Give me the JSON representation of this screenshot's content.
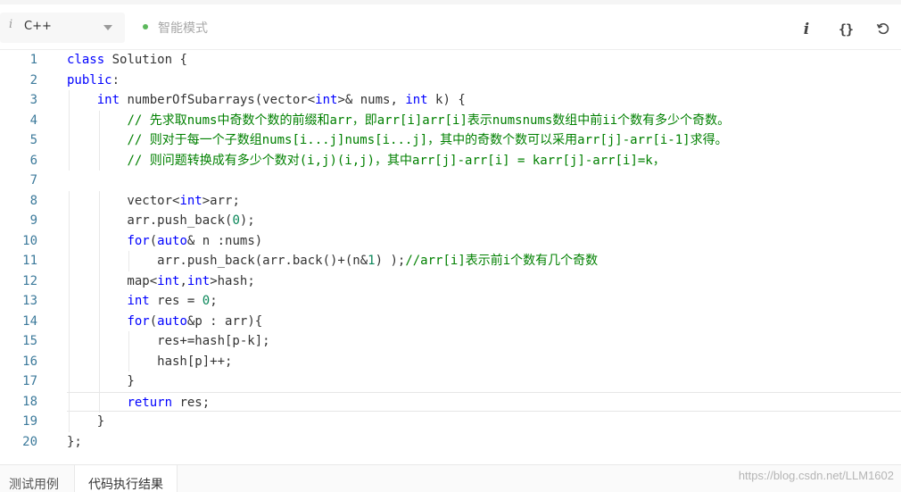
{
  "toolbar": {
    "language": "C++",
    "mode_label": "智能模式",
    "info_glyph": "i",
    "format_glyph": "{}",
    "colors": {
      "mode_dot": "#5cb85c"
    }
  },
  "editor": {
    "lines": [
      {
        "n": "1",
        "tokens": [
          {
            "t": "kw",
            "v": "class"
          },
          {
            "t": "pl",
            "v": " Solution {"
          }
        ]
      },
      {
        "n": "2",
        "tokens": [
          {
            "t": "kw",
            "v": "public"
          },
          {
            "t": "pl",
            "v": ":"
          }
        ]
      },
      {
        "n": "3",
        "tokens": [
          {
            "t": "pl",
            "v": "    "
          },
          {
            "t": "kw",
            "v": "int"
          },
          {
            "t": "pl",
            "v": " numberOfSubarrays(vector<"
          },
          {
            "t": "kw",
            "v": "int"
          },
          {
            "t": "pl",
            "v": ">& nums, "
          },
          {
            "t": "kw",
            "v": "int"
          },
          {
            "t": "pl",
            "v": " k) {"
          }
        ]
      },
      {
        "n": "4",
        "tokens": [
          {
            "t": "pl",
            "v": "        "
          },
          {
            "t": "cm",
            "v": "// 先求取nums中奇数个数的前缀和arr，即arr[i]arr[i]表示numsnums数组中前ii个数有多少个奇数。"
          }
        ]
      },
      {
        "n": "5",
        "tokens": [
          {
            "t": "pl",
            "v": "        "
          },
          {
            "t": "cm",
            "v": "// 则对于每一个子数组nums[i...j]nums[i...j]，其中的奇数个数可以采用arr[j]-arr[i-1]求得。"
          }
        ]
      },
      {
        "n": "6",
        "tokens": [
          {
            "t": "pl",
            "v": "        "
          },
          {
            "t": "cm",
            "v": "// 则问题转换成有多少个数对(i,j)(i,j)，其中arr[j]-arr[i] = karr[j]-arr[i]=k，"
          }
        ]
      },
      {
        "n": "7",
        "tokens": []
      },
      {
        "n": "8",
        "tokens": [
          {
            "t": "pl",
            "v": "        vector<"
          },
          {
            "t": "kw",
            "v": "int"
          },
          {
            "t": "pl",
            "v": ">arr;"
          }
        ]
      },
      {
        "n": "9",
        "tokens": [
          {
            "t": "pl",
            "v": "        arr.push_back("
          },
          {
            "t": "num",
            "v": "0"
          },
          {
            "t": "pl",
            "v": ");"
          }
        ]
      },
      {
        "n": "10",
        "tokens": [
          {
            "t": "pl",
            "v": "        "
          },
          {
            "t": "kw",
            "v": "for"
          },
          {
            "t": "pl",
            "v": "("
          },
          {
            "t": "kw",
            "v": "auto"
          },
          {
            "t": "pl",
            "v": "& n :nums)"
          }
        ]
      },
      {
        "n": "11",
        "tokens": [
          {
            "t": "pl",
            "v": "            arr.push_back(arr.back()+(n&"
          },
          {
            "t": "num",
            "v": "1"
          },
          {
            "t": "pl",
            "v": ") );"
          },
          {
            "t": "cm",
            "v": "//arr[i]表示前i个数有几个奇数"
          }
        ]
      },
      {
        "n": "12",
        "tokens": [
          {
            "t": "pl",
            "v": "        map<"
          },
          {
            "t": "kw",
            "v": "int"
          },
          {
            "t": "pl",
            "v": ","
          },
          {
            "t": "kw",
            "v": "int"
          },
          {
            "t": "pl",
            "v": ">hash;"
          }
        ]
      },
      {
        "n": "13",
        "tokens": [
          {
            "t": "pl",
            "v": "        "
          },
          {
            "t": "kw",
            "v": "int"
          },
          {
            "t": "pl",
            "v": " res = "
          },
          {
            "t": "num",
            "v": "0"
          },
          {
            "t": "pl",
            "v": ";"
          }
        ]
      },
      {
        "n": "14",
        "tokens": [
          {
            "t": "pl",
            "v": "        "
          },
          {
            "t": "kw",
            "v": "for"
          },
          {
            "t": "pl",
            "v": "("
          },
          {
            "t": "kw",
            "v": "auto"
          },
          {
            "t": "pl",
            "v": "&p : arr){"
          }
        ]
      },
      {
        "n": "15",
        "tokens": [
          {
            "t": "pl",
            "v": "            res+=hash[p-k];"
          }
        ]
      },
      {
        "n": "16",
        "tokens": [
          {
            "t": "pl",
            "v": "            hash[p]++;"
          }
        ]
      },
      {
        "n": "17",
        "tokens": [
          {
            "t": "pl",
            "v": "        }"
          }
        ]
      },
      {
        "n": "18",
        "tokens": [
          {
            "t": "pl",
            "v": "        "
          },
          {
            "t": "kw",
            "v": "return"
          },
          {
            "t": "pl",
            "v": " res;"
          }
        ],
        "active": true
      },
      {
        "n": "19",
        "tokens": [
          {
            "t": "pl",
            "v": "    }"
          }
        ]
      },
      {
        "n": "20",
        "tokens": [
          {
            "t": "pl",
            "v": "};"
          }
        ]
      }
    ]
  },
  "bottom": {
    "tabs": [
      {
        "label": "测试用例"
      },
      {
        "label": "代码执行结果"
      }
    ],
    "watermark": "https://blog.csdn.net/LLM1602"
  }
}
